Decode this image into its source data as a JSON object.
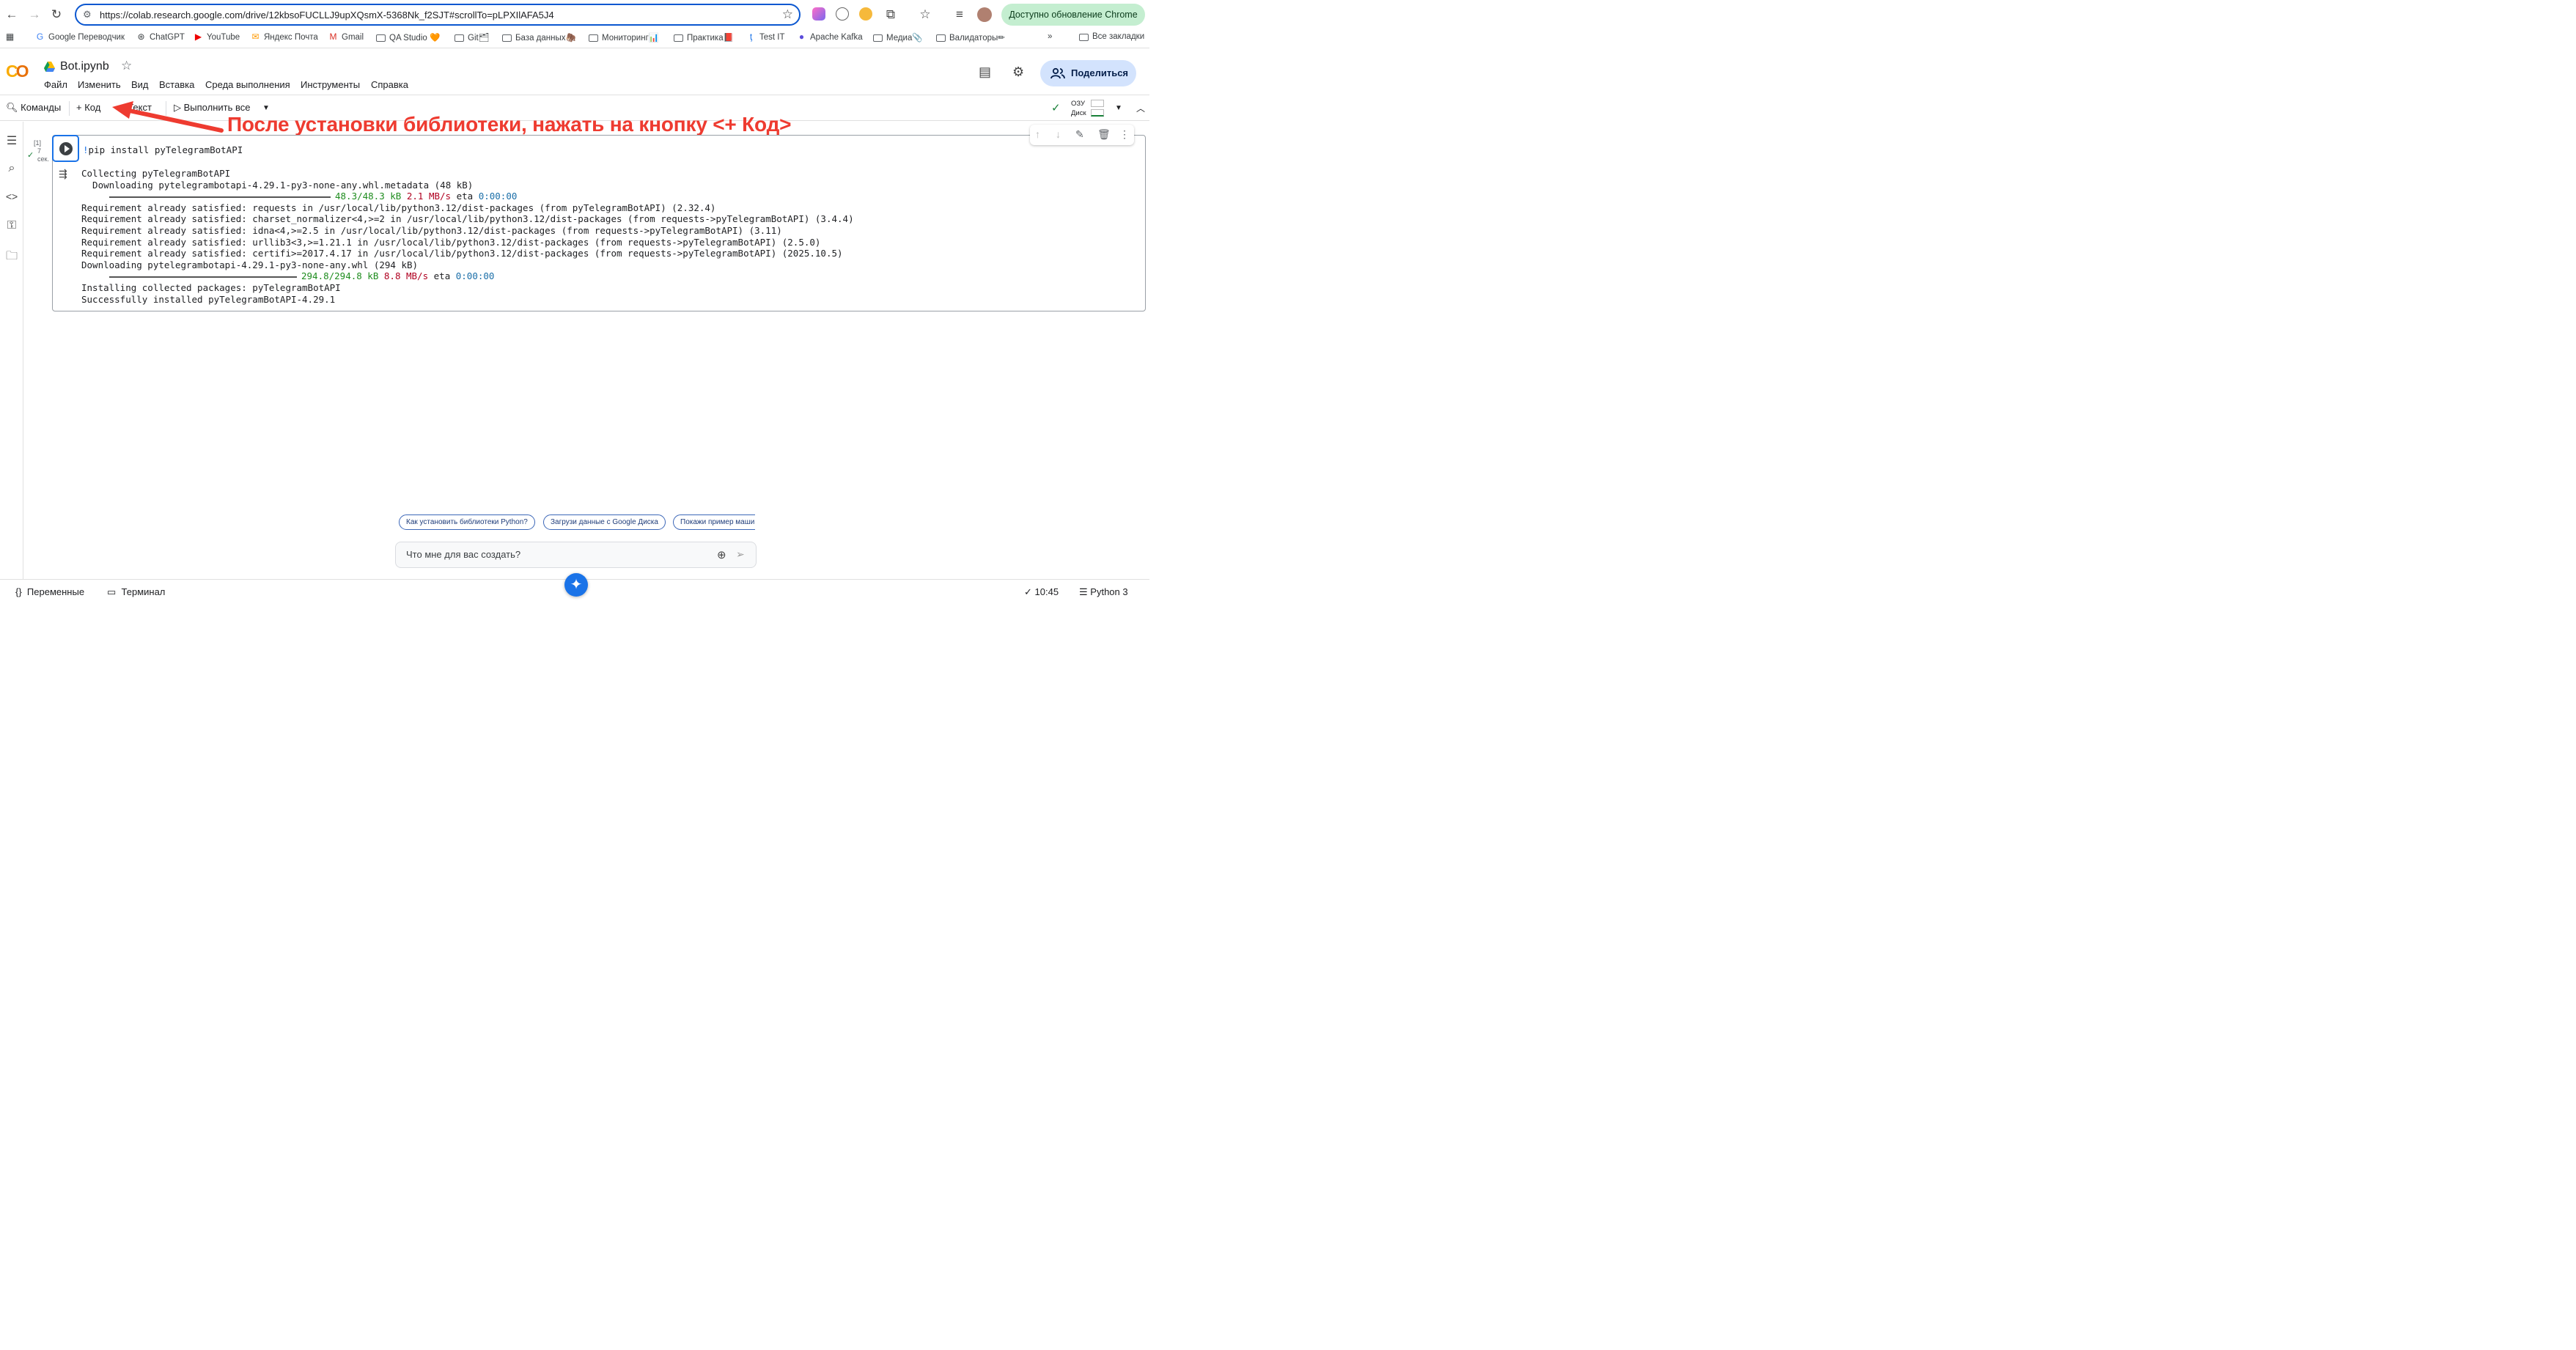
{
  "browser": {
    "url": "https://colab.research.google.com/drive/12kbsoFUCLLJ9upXQsmX-5368Nk_f2SJT#scrollTo=pLPXIlAFA5J4",
    "update_label": "Доступно обновление Chrome",
    "bookmarks": [
      "Google Переводчик",
      "ChatGPT",
      "YouTube",
      "Яндекс Почта",
      "Gmail",
      "QA Studio 🧡",
      "Git🗂",
      "База данных🦣",
      "Мониторинг📊",
      "Практика📕",
      "Test IT",
      "Apache Kafka",
      "Медиа📎",
      "Валидаторы✏",
      "»",
      "Все закладки"
    ]
  },
  "colab": {
    "notebook_name": "Bot.ipynb",
    "menu": [
      "Файл",
      "Изменить",
      "Вид",
      "Вставка",
      "Среда выполнения",
      "Инструменты",
      "Справка"
    ],
    "share_label": "Поделиться"
  },
  "toolbar": {
    "commands": "Команды",
    "add_code": "Код",
    "add_text": "Текст",
    "run_all": "Выполнить все",
    "ram": "ОЗУ",
    "disk": "Диск"
  },
  "annotation": "После установки библиотеки, нажать на кнопку <+ Код>",
  "cell": {
    "exec_count": "[1]",
    "exec_time_num": "7",
    "exec_time_unit": "сек.",
    "code_bang": "!",
    "code_rest": "pip install pyTelegramBotAPI",
    "output": {
      "l1": "Collecting pyTelegramBotAPI",
      "l2": "  Downloading pytelegrambotapi-4.29.1-py3-none-any.whl.metadata (48 kB)",
      "l3_size": "48.3/48.3 kB",
      "l3_speed": "2.1 MB/s",
      "l3_eta_label": "eta",
      "l3_eta": "0:00:00",
      "l4": "Requirement already satisfied: requests in /usr/local/lib/python3.12/dist-packages (from pyTelegramBotAPI) (2.32.4)",
      "l5": "Requirement already satisfied: charset_normalizer<4,>=2 in /usr/local/lib/python3.12/dist-packages (from requests->pyTelegramBotAPI) (3.4.4)",
      "l6": "Requirement already satisfied: idna<4,>=2.5 in /usr/local/lib/python3.12/dist-packages (from requests->pyTelegramBotAPI) (3.11)",
      "l7": "Requirement already satisfied: urllib3<3,>=1.21.1 in /usr/local/lib/python3.12/dist-packages (from requests->pyTelegramBotAPI) (2.5.0)",
      "l8": "Requirement already satisfied: certifi>=2017.4.17 in /usr/local/lib/python3.12/dist-packages (from requests->pyTelegramBotAPI) (2025.10.5)",
      "l9": "Downloading pytelegrambotapi-4.29.1-py3-none-any.whl (294 kB)",
      "l10_size": "294.8/294.8 kB",
      "l10_speed": "8.8 MB/s",
      "l10_eta_label": "eta",
      "l10_eta": "0:00:00",
      "l11": "Installing collected packages: pyTelegramBotAPI",
      "l12": "Successfully installed pyTelegramBotAPI-4.29.1"
    }
  },
  "suggestions": [
    "Как установить библиотеки Python?",
    "Загрузи данные с Google Диска",
    "Покажи пример маши"
  ],
  "prompt_placeholder": "Что мне для вас создать?",
  "status": {
    "variables": "Переменные",
    "terminal": "Терминал",
    "time": "10:45",
    "kernel": "Python 3"
  }
}
